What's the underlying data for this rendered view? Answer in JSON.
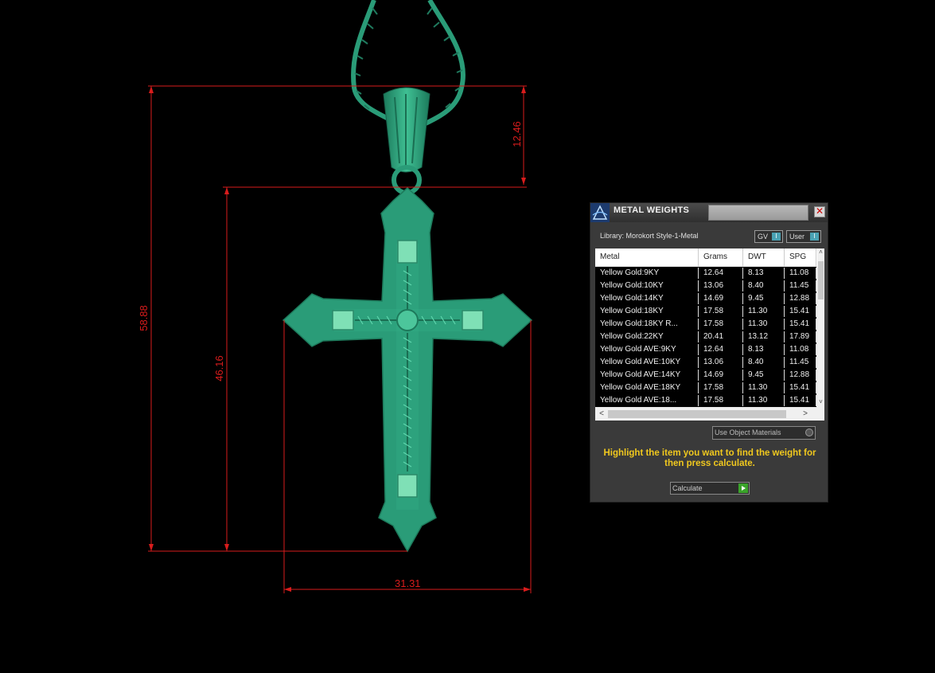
{
  "dimensions": {
    "total_height": "58.88",
    "cross_height": "46.16",
    "bail_height": "12.46",
    "width": "31.31"
  },
  "panel": {
    "title": "METAL WEIGHTS",
    "close_glyph": "✕",
    "library_label": "Library: Morokort Style-1-Metal",
    "gv_label": "GV",
    "gv_indicator": "I",
    "user_label": "User",
    "user_indicator": "I",
    "columns": [
      "Metal",
      "Grams",
      "DWT",
      "SPG"
    ],
    "rows": [
      [
        "Yellow Gold:9KY",
        "12.64",
        "8.13",
        "11.08"
      ],
      [
        "Yellow Gold:10KY",
        "13.06",
        "8.40",
        "11.45"
      ],
      [
        "Yellow Gold:14KY",
        "14.69",
        "9.45",
        "12.88"
      ],
      [
        "Yellow Gold:18KY",
        "17.58",
        "11.30",
        "15.41"
      ],
      [
        "Yellow Gold:18KY R...",
        "17.58",
        "11.30",
        "15.41"
      ],
      [
        "Yellow Gold:22KY",
        "20.41",
        "13.12",
        "17.89"
      ],
      [
        "Yellow Gold AVE:9KY",
        "12.64",
        "8.13",
        "11.08"
      ],
      [
        "Yellow Gold AVE:10KY",
        "13.06",
        "8.40",
        "11.45"
      ],
      [
        "Yellow Gold AVE:14KY",
        "14.69",
        "9.45",
        "12.88"
      ],
      [
        "Yellow Gold AVE:18KY",
        "17.58",
        "11.30",
        "15.41"
      ],
      [
        "Yellow Gold AVE:18...",
        "17.58",
        "11.30",
        "15.41"
      ]
    ],
    "scroll_up": "˄",
    "scroll_down": "˅",
    "scroll_left": "<",
    "scroll_right": ">",
    "use_object_materials": "Use Object Materials",
    "hint": "Highlight the item you want to find the weight for then press calculate.",
    "calculate_label": "Calculate"
  },
  "colors": {
    "metal_green": "#2a9c78",
    "dimension_red": "#d81c1c",
    "hint_yellow": "#f0c81e"
  }
}
